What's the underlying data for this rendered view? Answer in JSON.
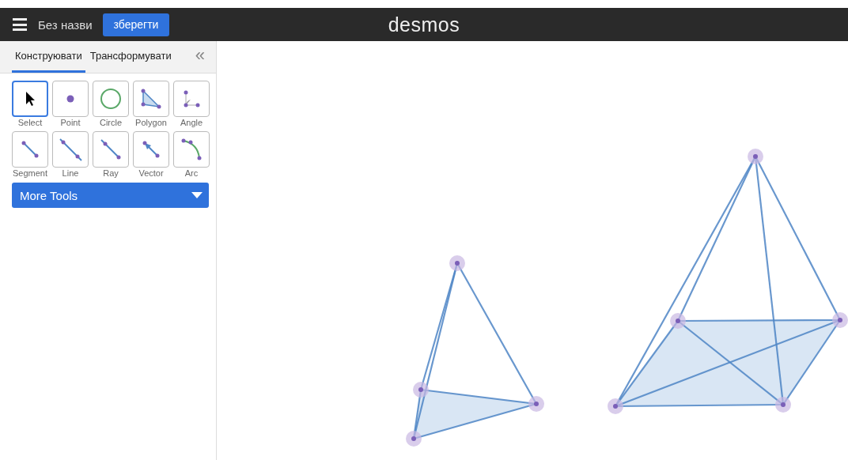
{
  "header": {
    "title": "Без назви",
    "save_button": "зберегти",
    "logo": "desmos"
  },
  "tabs": [
    {
      "label": "Конструювати",
      "selected": true
    },
    {
      "label": "Трансформувати",
      "selected": false
    }
  ],
  "collapse": "«",
  "tools": [
    {
      "kind": "select",
      "label": "Select",
      "selected": true
    },
    {
      "kind": "point",
      "label": "Point",
      "selected": false
    },
    {
      "kind": "circle",
      "label": "Circle",
      "selected": false
    },
    {
      "kind": "polygon",
      "label": "Polygon",
      "selected": false
    },
    {
      "kind": "angle",
      "label": "Angle",
      "selected": false
    },
    {
      "kind": "segment",
      "label": "Segment",
      "selected": false
    },
    {
      "kind": "line",
      "label": "Line",
      "selected": false
    },
    {
      "kind": "ray",
      "label": "Ray",
      "selected": false
    },
    {
      "kind": "vector",
      "label": "Vector",
      "selected": false
    },
    {
      "kind": "arc",
      "label": "Arc",
      "selected": false
    }
  ],
  "more_tools": "More Tools"
}
